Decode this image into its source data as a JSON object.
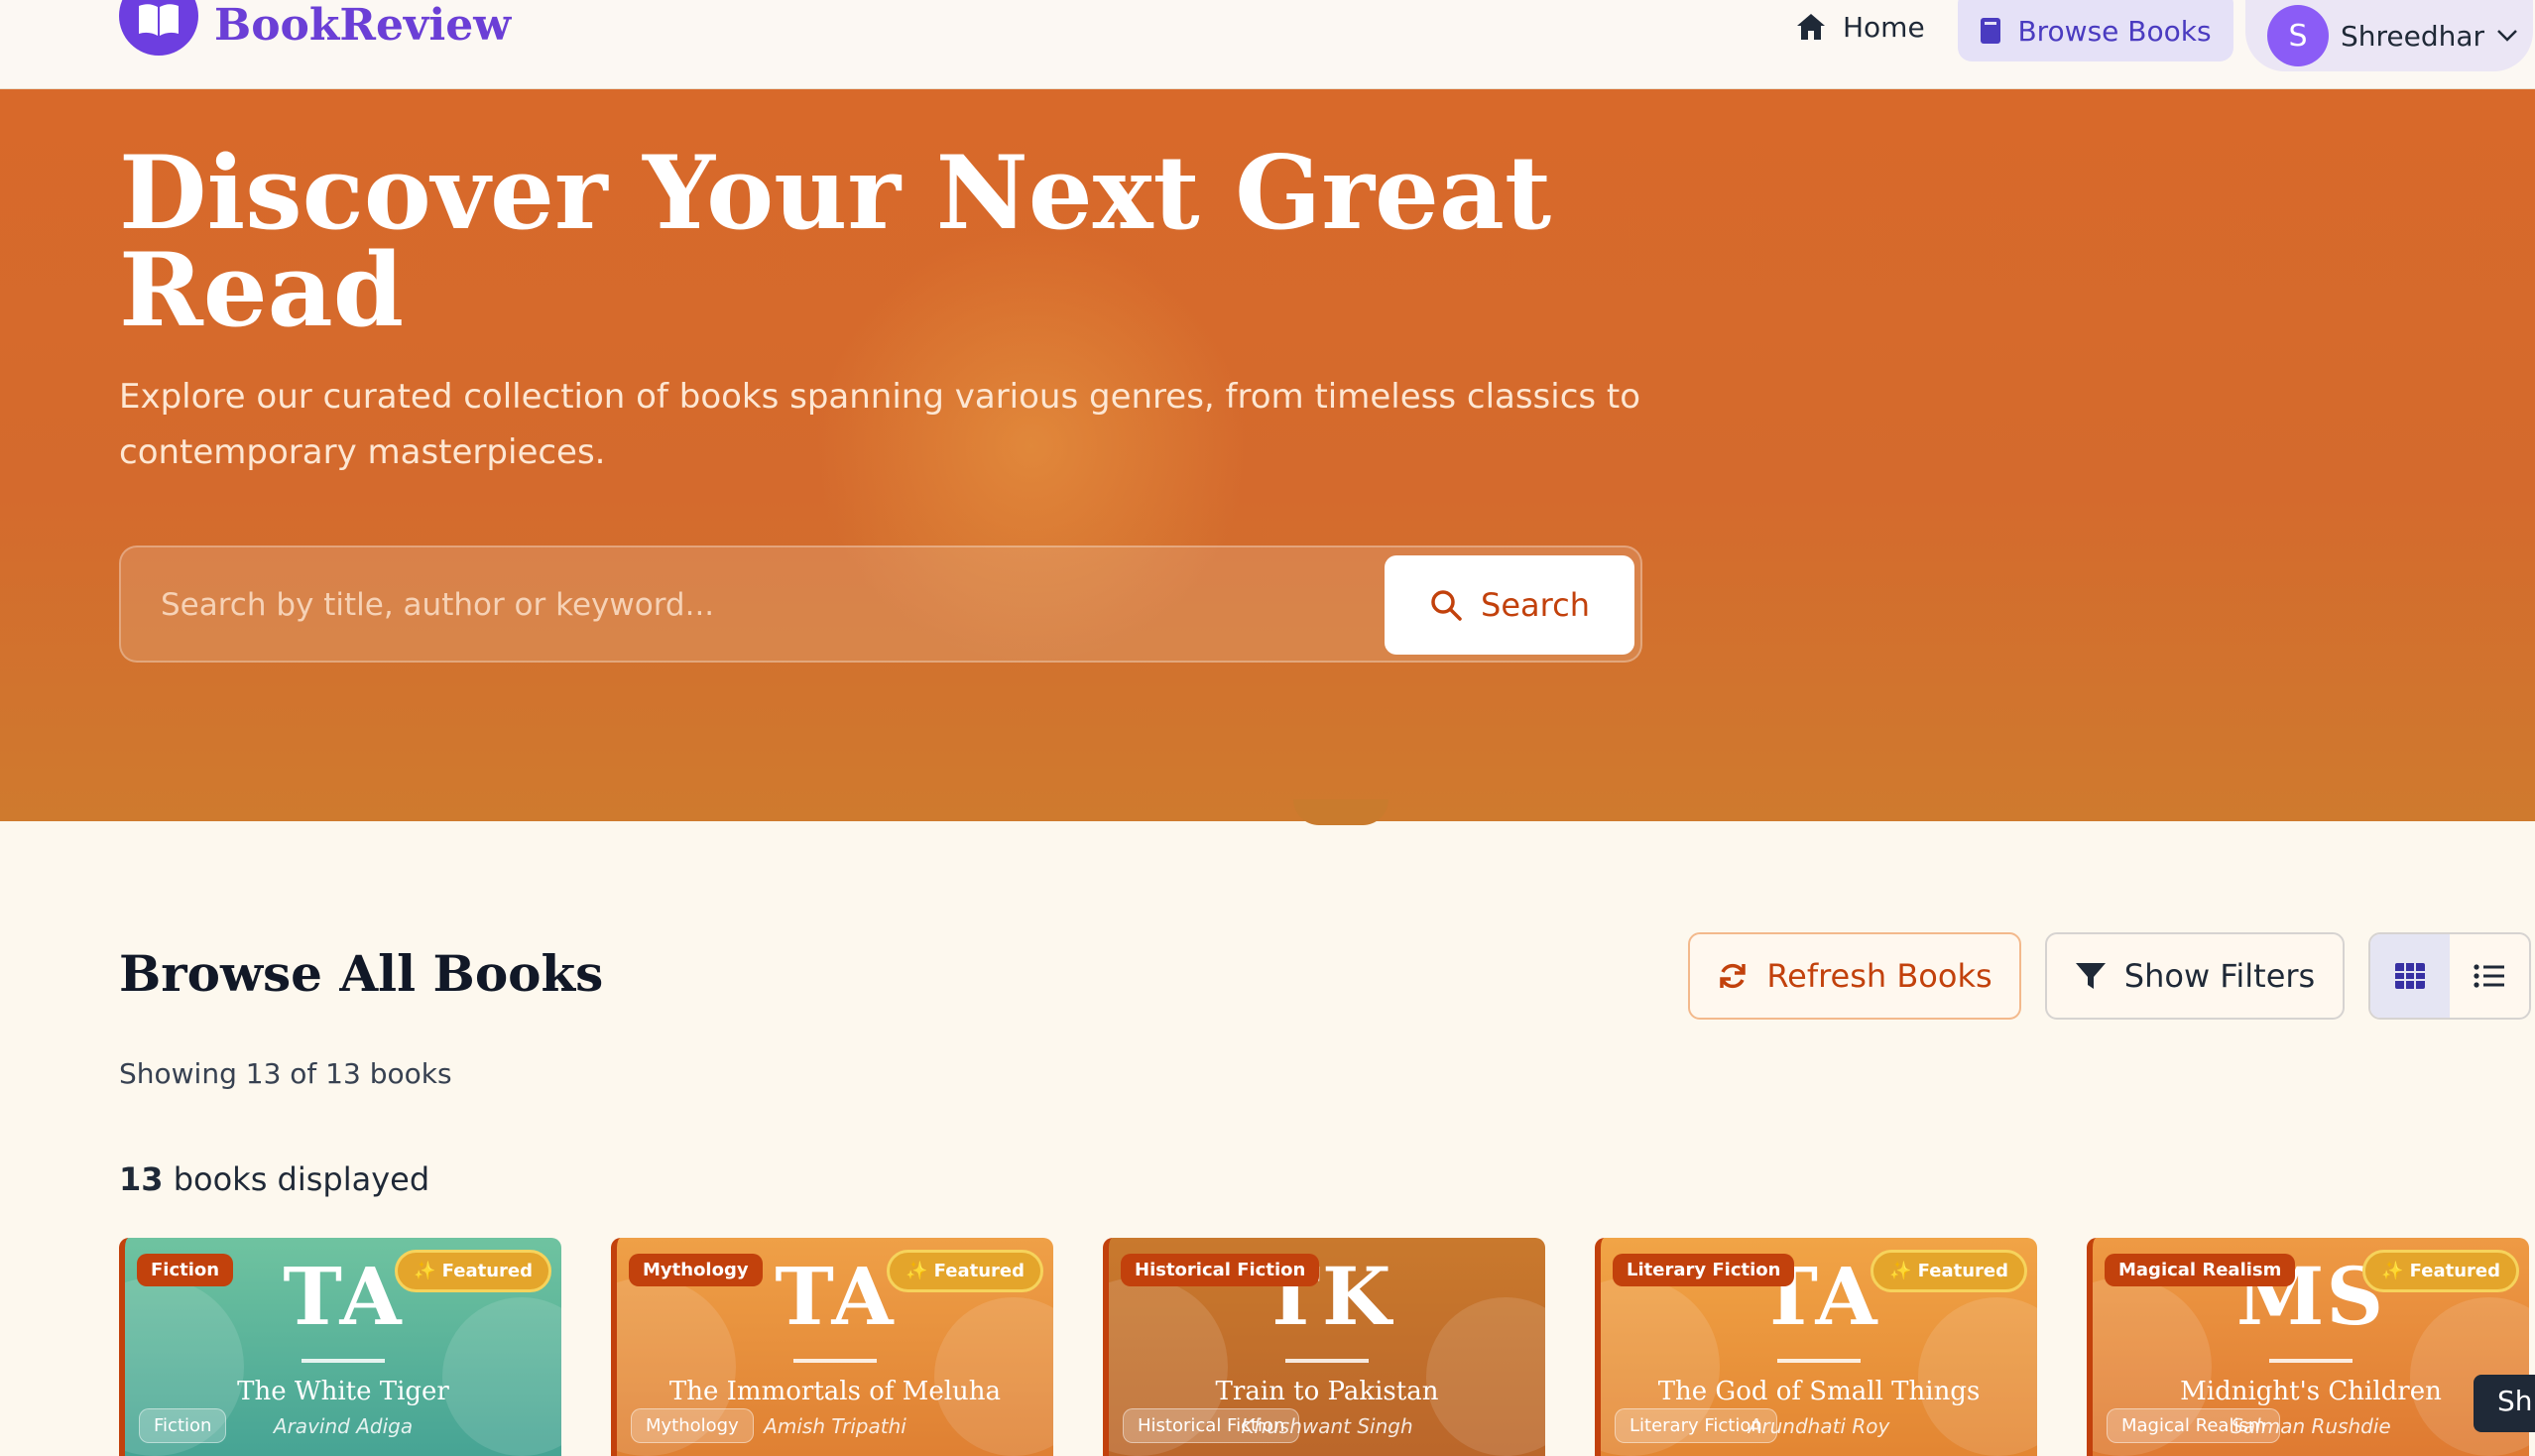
{
  "header": {
    "brand": "BookReview",
    "nav": {
      "home": "Home",
      "browse": "Browse Books"
    },
    "user": {
      "initial": "S",
      "name": "Shreedhar"
    }
  },
  "hero": {
    "title": "Discover Your Next Great Read",
    "subtitle": "Explore our curated collection of books spanning various genres, from timeless classics to contemporary masterpieces.",
    "search": {
      "placeholder": "Search by title, author or keyword...",
      "button": "Search"
    }
  },
  "browse": {
    "title": "Browse All Books",
    "refresh": "Refresh Books",
    "filters": "Show Filters",
    "showing": "Showing 13 of 13 books",
    "displayed_count": "13",
    "displayed_label": "books displayed",
    "featured_label": "✨ Featured"
  },
  "books": [
    {
      "initials": "TA",
      "title": "The White Tiger",
      "author": "Aravind Adiga",
      "genre": "Fiction",
      "featured": true,
      "color_top": "#6fc3a0",
      "color_bottom": "#3f9e92"
    },
    {
      "initials": "TA",
      "title": "The Immortals of Meluha",
      "author": "Amish Tripathi",
      "genre": "Mythology",
      "featured": true,
      "color_top": "#efa047",
      "color_bottom": "#dc7a2f"
    },
    {
      "initials": "TK",
      "title": "Train to Pakistan",
      "author": "Khushwant Singh",
      "genre": "Historical Fiction",
      "featured": false,
      "color_top": "#c9792d",
      "color_bottom": "#b8632a"
    },
    {
      "initials": "TA",
      "title": "The God of Small Things",
      "author": "Arundhati Roy",
      "genre": "Literary Fiction",
      "featured": true,
      "color_top": "#f1a446",
      "color_bottom": "#e0802f"
    },
    {
      "initials": "MS",
      "title": "Midnight's Children",
      "author": "Salman Rushdie",
      "genre": "Magical Realism",
      "featured": true,
      "color_top": "#ee9a44",
      "color_bottom": "#dc742e"
    }
  ],
  "tooltip": "Sh",
  "colors": {
    "accent": "#c2410c",
    "brand": "#6b3fd6",
    "hero": "#d8692a"
  }
}
